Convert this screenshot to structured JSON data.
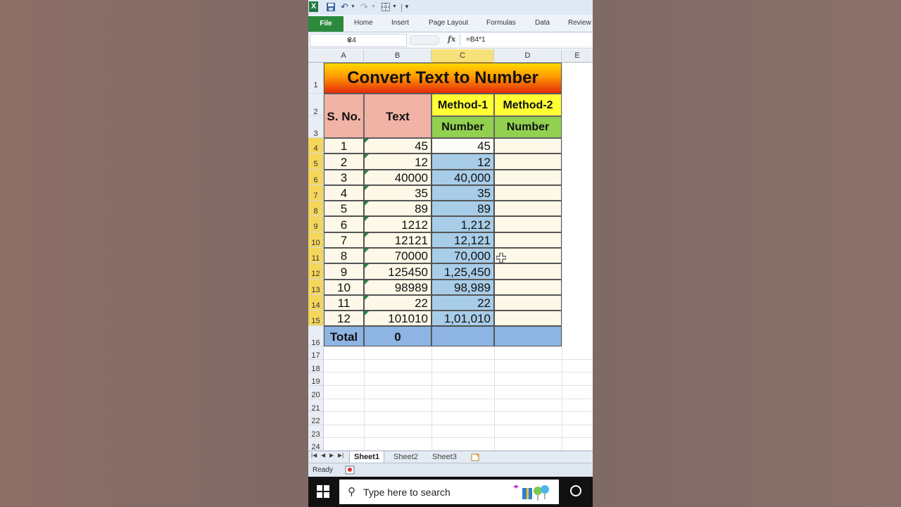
{
  "qat": {
    "undo": "↶",
    "redo": "↷"
  },
  "ribbon": {
    "tabs": [
      "File",
      "Home",
      "Insert",
      "Page Layout",
      "Formulas",
      "Data",
      "Review"
    ]
  },
  "formula_bar": {
    "name_box": "C4",
    "fx": "fx",
    "formula": "=B4*1"
  },
  "columns": [
    "A",
    "B",
    "C",
    "D",
    "E"
  ],
  "selected_column": "C",
  "rows": [
    "1",
    "2",
    "3",
    "4",
    "5",
    "6",
    "7",
    "8",
    "9",
    "10",
    "11",
    "12",
    "13",
    "14",
    "15",
    "16",
    "17",
    "18",
    "19",
    "20",
    "21",
    "22",
    "23",
    "24"
  ],
  "sheet": {
    "title": "Convert Text to Number",
    "header_sno": "S. No.",
    "header_text": "Text",
    "header_m1": "Method-1",
    "header_m2": "Method-2",
    "header_num1": "Number",
    "header_num2": "Number",
    "data": [
      {
        "sno": "1",
        "text": "45",
        "m1": "45"
      },
      {
        "sno": "2",
        "text": "12",
        "m1": "12"
      },
      {
        "sno": "3",
        "text": "40000",
        "m1": "40,000"
      },
      {
        "sno": "4",
        "text": "35",
        "m1": "35"
      },
      {
        "sno": "5",
        "text": "89",
        "m1": "89"
      },
      {
        "sno": "6",
        "text": "1212",
        "m1": "1,212"
      },
      {
        "sno": "7",
        "text": "12121",
        "m1": "12,121"
      },
      {
        "sno": "8",
        "text": "70000",
        "m1": "70,000"
      },
      {
        "sno": "9",
        "text": "125450",
        "m1": "1,25,450"
      },
      {
        "sno": "10",
        "text": "98989",
        "m1": "98,989"
      },
      {
        "sno": "11",
        "text": "22",
        "m1": "22"
      },
      {
        "sno": "12",
        "text": "101010",
        "m1": "1,01,010"
      }
    ],
    "total_label": "Total",
    "total_value": "0"
  },
  "sheet_tabs": [
    "Sheet1",
    "Sheet2",
    "Sheet3"
  ],
  "status": {
    "ready": "Ready"
  },
  "taskbar": {
    "search_placeholder": "Type here to search"
  },
  "colors": {
    "title_top": "#ffd800",
    "title_bottom": "#e52b0c",
    "method1_yellow": "#ffff33",
    "number_green": "#92d050",
    "selected_blue": "#a8cde8",
    "total_blue": "#8db4e3",
    "excel_green": "#2a8a3c"
  }
}
